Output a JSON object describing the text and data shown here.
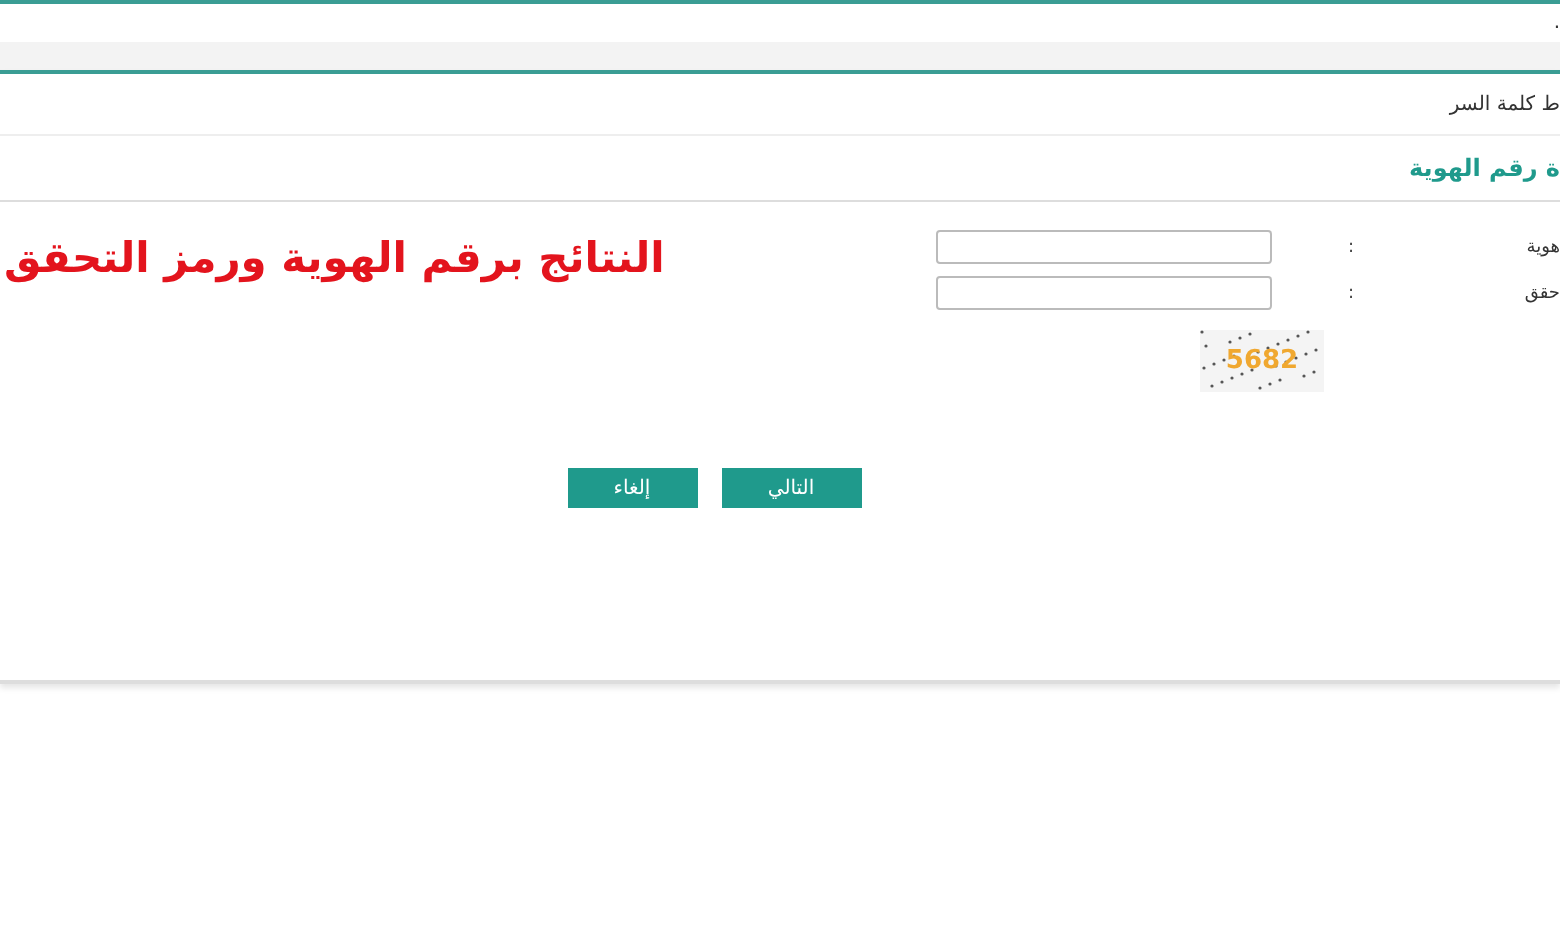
{
  "top_bar": {
    "text": "."
  },
  "breadcrumb": "ط كلمة السر",
  "section_title": "ة رقم الهوية",
  "headline": "النتائج برقم الهوية ورمز التحقق",
  "fields": [
    {
      "label": "هوية",
      "colon": ":"
    },
    {
      "label": "حقق",
      "colon": ":"
    }
  ],
  "captcha": {
    "code": "5682"
  },
  "buttons": [
    {
      "label": "التالي"
    },
    {
      "label": "إلغاء"
    }
  ]
}
